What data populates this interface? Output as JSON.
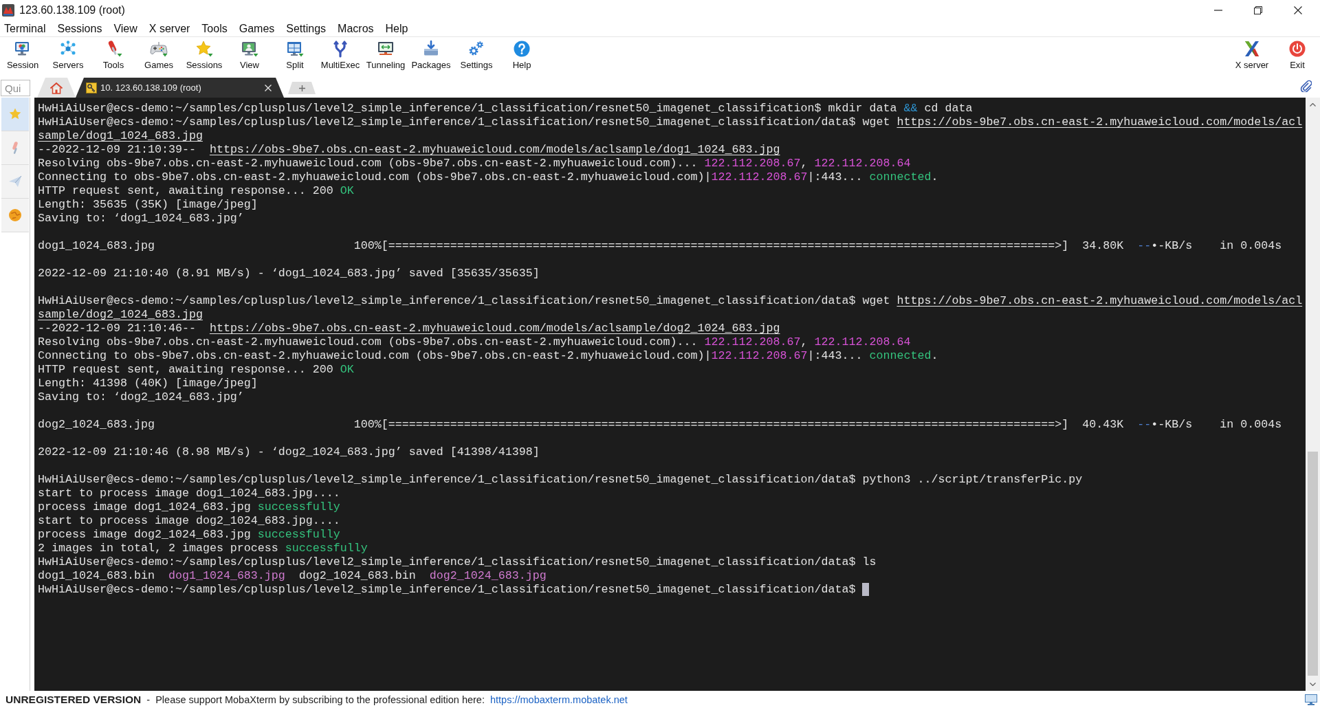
{
  "window": {
    "title": "123.60.138.109 (root)"
  },
  "menu_bar": [
    "Terminal",
    "Sessions",
    "View",
    "X server",
    "Tools",
    "Games",
    "Settings",
    "Macros",
    "Help"
  ],
  "toolbar": {
    "items": [
      {
        "label": "Session",
        "dropdown": false
      },
      {
        "label": "Servers",
        "dropdown": false
      },
      {
        "label": "Tools",
        "dropdown": true
      },
      {
        "label": "Games",
        "dropdown": true
      },
      {
        "label": "Sessions",
        "dropdown": true
      },
      {
        "label": "View",
        "dropdown": true
      },
      {
        "label": "Split",
        "dropdown": true
      },
      {
        "label": "MultiExec",
        "dropdown": false
      },
      {
        "label": "Tunneling",
        "dropdown": false
      },
      {
        "label": "Packages",
        "dropdown": false
      },
      {
        "label": "Settings",
        "dropdown": false
      },
      {
        "label": "Help",
        "dropdown": false
      }
    ],
    "right_items": [
      {
        "label": "X server"
      },
      {
        "label": "Exit"
      }
    ]
  },
  "tab_bar": {
    "quick_connect": {
      "placeholder": "Qui"
    },
    "tabs": [
      {
        "kind": "home",
        "selected": false
      },
      {
        "kind": "session",
        "label": "10. 123.60.138.109 (root)",
        "selected": true
      }
    ]
  },
  "sidebar": {
    "tabs": [
      {
        "selected": true
      },
      {
        "selected": false
      },
      {
        "selected": false
      },
      {
        "selected": false
      }
    ]
  },
  "terminal": {
    "lines": [
      {
        "kind": "output",
        "segments": [
          {
            "text": "HwHiAiUser@ecs-demo:~/samples/cplusplus/level2_simple_inference/1_classification/resnet50_imagenet_classification$ mkdir data ",
            "kind": "text"
          },
          {
            "text": "&&",
            "kind": "operator"
          },
          {
            "text": " cd data",
            "kind": "text"
          }
        ]
      },
      {
        "kind": "output",
        "segments": [
          {
            "text": "HwHiAiUser@ecs-demo:~/samples/cplusplus/level2_simple_inference/1_classification/resnet50_imagenet_classification/data$ wget ",
            "kind": "text"
          },
          {
            "text": "https://obs-9be7.obs.cn-east-2.myhuaweicloud.com/models/acl",
            "kind": "link"
          }
        ]
      },
      {
        "kind": "output",
        "segments": [
          {
            "text": "sample/dog1_1024_683.jpg",
            "kind": "link"
          }
        ]
      },
      {
        "kind": "output",
        "segments": [
          {
            "text": "--2022-12-09 21:10:39--  ",
            "kind": "text"
          },
          {
            "text": "https://obs-9be7.obs.cn-east-2.myhuaweicloud.com/models/aclsample/dog1_1024_683.jpg",
            "kind": "link"
          }
        ]
      },
      {
        "kind": "output",
        "segments": [
          {
            "text": "Resolving obs-9be7.obs.cn-east-2.myhuaweicloud.com (obs-9be7.obs.cn-east-2.myhuaweicloud.com)... ",
            "kind": "text"
          },
          {
            "text": "122.112.208.67",
            "kind": "ip"
          },
          {
            "text": ", ",
            "kind": "text"
          },
          {
            "text": "122.112.208.64",
            "kind": "ip"
          }
        ]
      },
      {
        "kind": "output",
        "segments": [
          {
            "text": "Connecting to obs-9be7.obs.cn-east-2.myhuaweicloud.com (obs-9be7.obs.cn-east-2.myhuaweicloud.com)|",
            "kind": "text"
          },
          {
            "text": "122.112.208.67",
            "kind": "ip"
          },
          {
            "text": "|:443... ",
            "kind": "text"
          },
          {
            "text": "connected",
            "kind": "success"
          },
          {
            "text": ".",
            "kind": "text"
          }
        ]
      },
      {
        "kind": "output",
        "segments": [
          {
            "text": "HTTP request sent, awaiting response... 200 ",
            "kind": "text"
          },
          {
            "text": "OK",
            "kind": "success"
          }
        ]
      },
      {
        "kind": "output",
        "segments": [
          {
            "text": "Length: 35635 (35K) [image/jpeg]",
            "kind": "text"
          }
        ]
      },
      {
        "kind": "output",
        "segments": [
          {
            "text": "Saving to: ‘dog1_1024_683.jpg’",
            "kind": "text"
          }
        ]
      },
      {
        "kind": "blank"
      },
      {
        "kind": "output",
        "segments": [
          {
            "text": "dog1_1024_683.jpg                             100%[=================================================================================================>]  34.80K  ",
            "kind": "text"
          },
          {
            "text": "--",
            "kind": "rate"
          },
          {
            "text": "•-KB/s    in 0.004s",
            "kind": "text"
          }
        ]
      },
      {
        "kind": "blank"
      },
      {
        "kind": "output",
        "segments": [
          {
            "text": "2022-12-09 21:10:40 (8.91 MB/s) - ‘dog1_1024_683.jpg’ saved [35635/35635]",
            "kind": "text"
          }
        ]
      },
      {
        "kind": "blank"
      },
      {
        "kind": "output",
        "segments": [
          {
            "text": "HwHiAiUser@ecs-demo:~/samples/cplusplus/level2_simple_inference/1_classification/resnet50_imagenet_classification/data$ wget ",
            "kind": "text"
          },
          {
            "text": "https://obs-9be7.obs.cn-east-2.myhuaweicloud.com/models/acl",
            "kind": "link"
          }
        ]
      },
      {
        "kind": "output",
        "segments": [
          {
            "text": "sample/dog2_1024_683.jpg",
            "kind": "link"
          }
        ]
      },
      {
        "kind": "output",
        "segments": [
          {
            "text": "--2022-12-09 21:10:46--  ",
            "kind": "text"
          },
          {
            "text": "https://obs-9be7.obs.cn-east-2.myhuaweicloud.com/models/aclsample/dog2_1024_683.jpg",
            "kind": "link"
          }
        ]
      },
      {
        "kind": "output",
        "segments": [
          {
            "text": "Resolving obs-9be7.obs.cn-east-2.myhuaweicloud.com (obs-9be7.obs.cn-east-2.myhuaweicloud.com)... ",
            "kind": "text"
          },
          {
            "text": "122.112.208.67",
            "kind": "ip"
          },
          {
            "text": ", ",
            "kind": "text"
          },
          {
            "text": "122.112.208.64",
            "kind": "ip"
          }
        ]
      },
      {
        "kind": "output",
        "segments": [
          {
            "text": "Connecting to obs-9be7.obs.cn-east-2.myhuaweicloud.com (obs-9be7.obs.cn-east-2.myhuaweicloud.com)|",
            "kind": "text"
          },
          {
            "text": "122.112.208.67",
            "kind": "ip"
          },
          {
            "text": "|:443... ",
            "kind": "text"
          },
          {
            "text": "connected",
            "kind": "success"
          },
          {
            "text": ".",
            "kind": "text"
          }
        ]
      },
      {
        "kind": "output",
        "segments": [
          {
            "text": "HTTP request sent, awaiting response... 200 ",
            "kind": "text"
          },
          {
            "text": "OK",
            "kind": "success"
          }
        ]
      },
      {
        "kind": "output",
        "segments": [
          {
            "text": "Length: 41398 (40K) [image/jpeg]",
            "kind": "text"
          }
        ]
      },
      {
        "kind": "output",
        "segments": [
          {
            "text": "Saving to: ‘dog2_1024_683.jpg’",
            "kind": "text"
          }
        ]
      },
      {
        "kind": "blank"
      },
      {
        "kind": "output",
        "segments": [
          {
            "text": "dog2_1024_683.jpg                             100%[=================================================================================================>]  40.43K  ",
            "kind": "text"
          },
          {
            "text": "--",
            "kind": "rate"
          },
          {
            "text": "•-KB/s    in 0.004s",
            "kind": "text"
          }
        ]
      },
      {
        "kind": "blank"
      },
      {
        "kind": "output",
        "segments": [
          {
            "text": "2022-12-09 21:10:46 (8.98 MB/s) - ‘dog2_1024_683.jpg’ saved [41398/41398]",
            "kind": "text"
          }
        ]
      },
      {
        "kind": "blank"
      },
      {
        "kind": "output",
        "segments": [
          {
            "text": "HwHiAiUser@ecs-demo:~/samples/cplusplus/level2_simple_inference/1_classification/resnet50_imagenet_classification/data$ python3 ../script/transferPic.py",
            "kind": "text"
          }
        ]
      },
      {
        "kind": "output",
        "segments": [
          {
            "text": "start to process image dog1_1024_683.jpg....",
            "kind": "text"
          }
        ]
      },
      {
        "kind": "output",
        "segments": [
          {
            "text": "process image dog1_1024_683.jpg ",
            "kind": "text"
          },
          {
            "text": "successfully",
            "kind": "success"
          }
        ]
      },
      {
        "kind": "output",
        "segments": [
          {
            "text": "start to process image dog2_1024_683.jpg....",
            "kind": "text"
          }
        ]
      },
      {
        "kind": "output",
        "segments": [
          {
            "text": "process image dog2_1024_683.jpg ",
            "kind": "text"
          },
          {
            "text": "successfully",
            "kind": "success"
          }
        ]
      },
      {
        "kind": "output",
        "segments": [
          {
            "text": "2 images in total, 2 images process ",
            "kind": "text"
          },
          {
            "text": "successfully",
            "kind": "success"
          }
        ]
      },
      {
        "kind": "output",
        "segments": [
          {
            "text": "HwHiAiUser@ecs-demo:~/samples/cplusplus/level2_simple_inference/1_classification/resnet50_imagenet_classification/data$ ls",
            "kind": "text"
          }
        ]
      },
      {
        "kind": "output",
        "segments": [
          {
            "text": "dog1_1024_683.bin  ",
            "kind": "text"
          },
          {
            "text": "dog1_1024_683.jpg",
            "kind": "image"
          },
          {
            "text": "  dog2_1024_683.bin  ",
            "kind": "text"
          },
          {
            "text": "dog2_1024_683.jpg",
            "kind": "image"
          }
        ]
      },
      {
        "kind": "output",
        "segments": [
          {
            "text": "HwHiAiUser@ecs-demo:~/samples/cplusplus/level2_simple_inference/1_classification/resnet50_imagenet_classification/data$ ",
            "kind": "text"
          },
          {
            "kind": "cursor"
          }
        ]
      }
    ]
  },
  "status_bar": {
    "message": "**UNREGISTERED VERSION**  -  Please support MobaXterm by subscribing to the professional edition here:",
    "link": "https://mobaxterm.mobatek.net"
  }
}
